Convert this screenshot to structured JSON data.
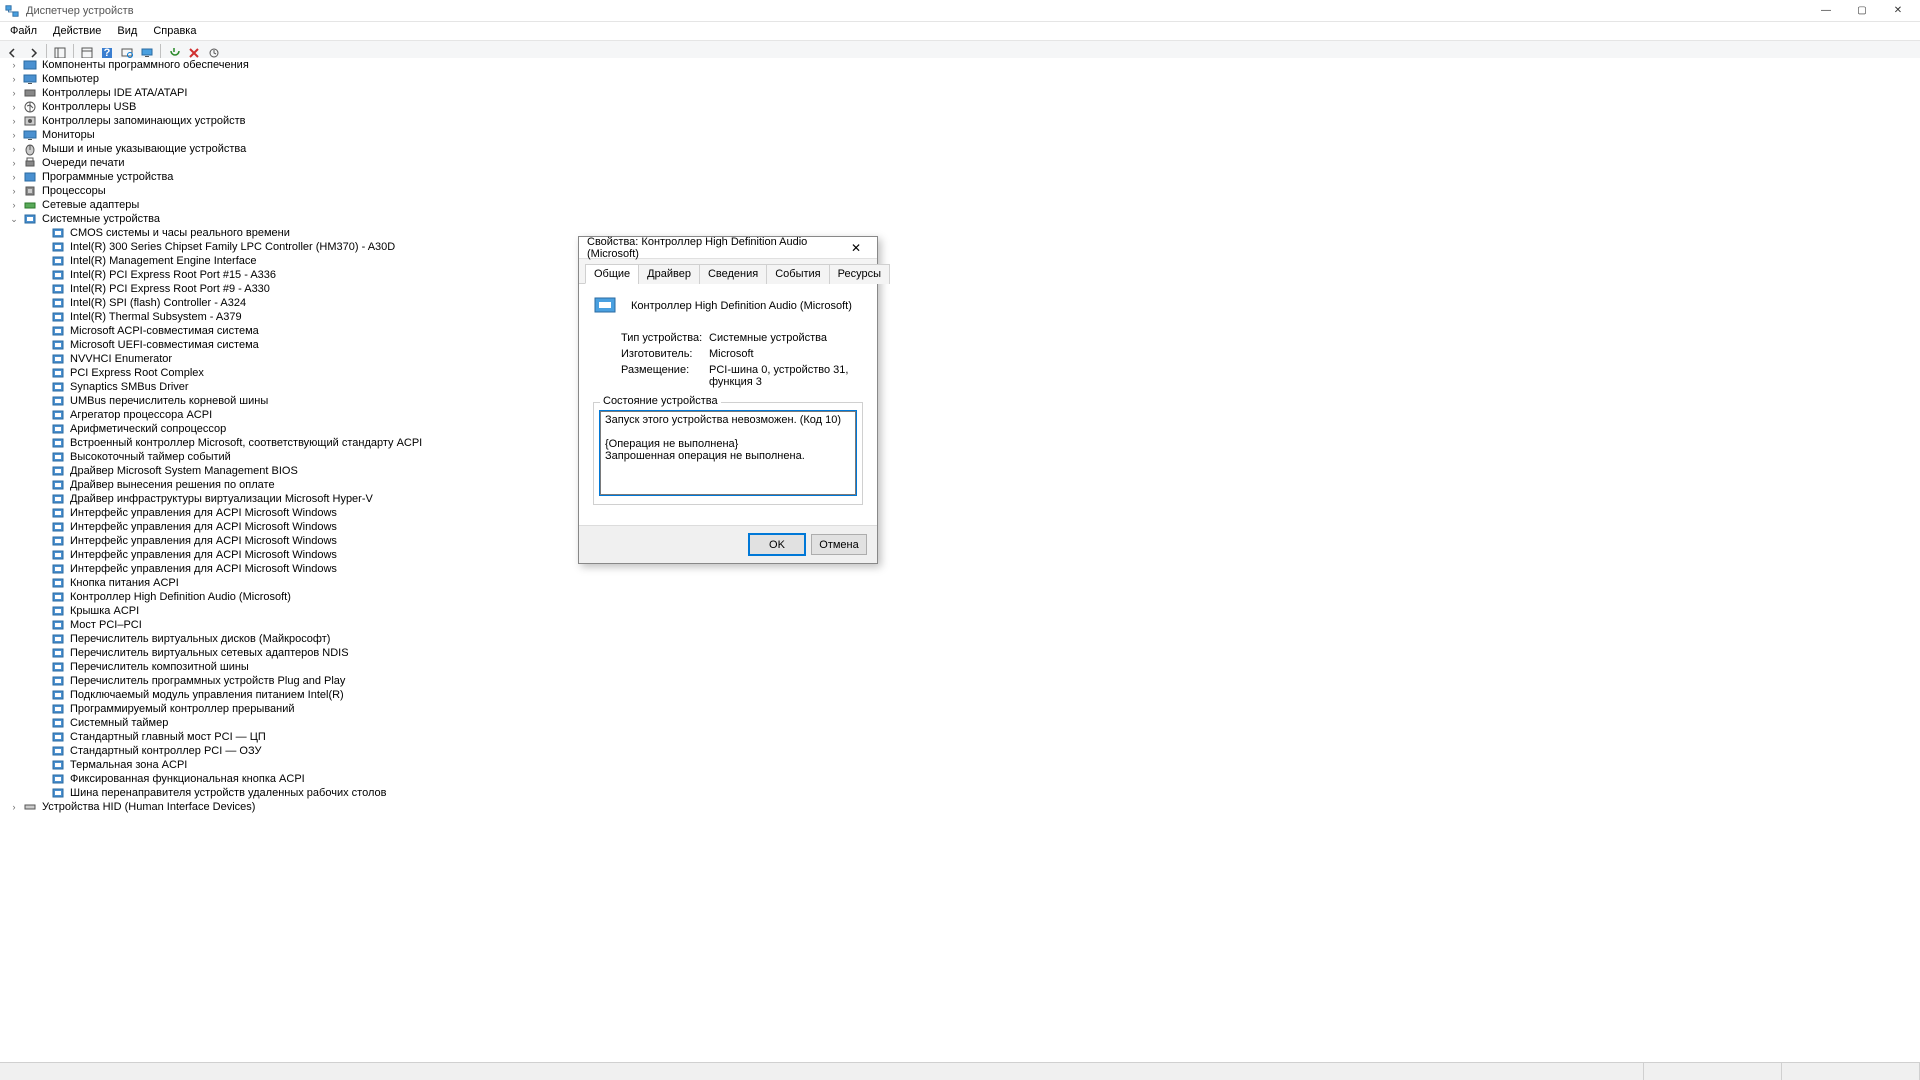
{
  "window": {
    "title": "Диспетчер устройств",
    "min": "—",
    "max": "▢",
    "close": "✕"
  },
  "menu": {
    "file": "Файл",
    "action": "Действие",
    "view": "Вид",
    "help": "Справка"
  },
  "tree": {
    "categories": [
      {
        "label": "Компоненты программного обеспечения",
        "icon": "sw-component"
      },
      {
        "label": "Компьютер",
        "icon": "computer"
      },
      {
        "label": "Контроллеры IDE ATA/ATAPI",
        "icon": "ide"
      },
      {
        "label": "Контроллеры USB",
        "icon": "usb"
      },
      {
        "label": "Контроллеры запоминающих устройств",
        "icon": "storage"
      },
      {
        "label": "Мониторы",
        "icon": "monitor"
      },
      {
        "label": "Мыши и иные указывающие устройства",
        "icon": "mouse"
      },
      {
        "label": "Очереди печати",
        "icon": "printer"
      },
      {
        "label": "Программные устройства",
        "icon": "swdev"
      },
      {
        "label": "Процессоры",
        "icon": "cpu"
      },
      {
        "label": "Сетевые адаптеры",
        "icon": "net"
      },
      {
        "label": "Системные устройства",
        "icon": "system",
        "expanded": true
      },
      {
        "label": "Устройства HID (Human Interface Devices)",
        "icon": "hid"
      }
    ],
    "system_children": [
      "CMOS системы и часы реального времени",
      "Intel(R) 300 Series Chipset Family LPC Controller (HM370) - A30D",
      "Intel(R) Management Engine Interface",
      "Intel(R) PCI Express Root Port #15 - A336",
      "Intel(R) PCI Express Root Port #9 - A330",
      "Intel(R) SPI (flash) Controller - A324",
      "Intel(R) Thermal Subsystem - A379",
      "Microsoft ACPI-совместимая система",
      "Microsoft UEFI-совместимая система",
      "NVVHCI Enumerator",
      "PCI Express Root Complex",
      "Synaptics SMBus Driver",
      "UMBus перечислитель корневой шины",
      "Агрегатор процессора ACPI",
      "Арифметический сопроцессор",
      "Встроенный контроллер Microsoft, соответствующий стандарту ACPI",
      "Высокоточный таймер событий",
      "Драйвер Microsoft System Management BIOS",
      "Драйвер вынесения решения по оплате",
      "Драйвер инфраструктуры виртуализации Microsoft Hyper-V",
      "Интерфейс управления для ACPI Microsoft Windows",
      "Интерфейс управления для ACPI Microsoft Windows",
      "Интерфейс управления для ACPI Microsoft Windows",
      "Интерфейс управления для ACPI Microsoft Windows",
      "Интерфейс управления для ACPI Microsoft Windows",
      "Кнопка питания ACPI",
      "Контроллер High Definition Audio (Microsoft)",
      "Крышка ACPI",
      "Мост PCI–PCI",
      "Перечислитель виртуальных дисков (Майкрософт)",
      "Перечислитель виртуальных сетевых адаптеров NDIS",
      "Перечислитель композитной шины",
      "Перечислитель программных устройств Plug and Play",
      "Подключаемый модуль управления питанием Intel(R)",
      "Программируемый контроллер прерываний",
      "Системный таймер",
      "Стандартный главный мост PCI — ЦП",
      "Стандартный контроллер PCI — ОЗУ",
      "Термальная зона ACPI",
      "Фиксированная функциональная кнопка ACPI",
      "Шина перенаправителя устройств удаленных рабочих столов"
    ]
  },
  "dialog": {
    "title": "Свойства: Контроллер High Definition Audio (Microsoft)",
    "tabs": {
      "general": "Общие",
      "driver": "Драйвер",
      "details": "Сведения",
      "events": "События",
      "resources": "Ресурсы"
    },
    "device_name": "Контроллер High Definition Audio (Microsoft)",
    "labels": {
      "type": "Тип устройства:",
      "mfg": "Изготовитель:",
      "loc": "Размещение:",
      "status_group": "Состояние устройства"
    },
    "values": {
      "type": "Системные устройства",
      "mfg": "Microsoft",
      "loc": "PCI-шина 0, устройство 31, функция 3"
    },
    "status_text": "Запуск этого устройства невозможен. (Код 10)\n\n{Операция не выполнена}\nЗапрошенная операция не выполнена.",
    "ok": "OK",
    "cancel": "Отмена"
  }
}
